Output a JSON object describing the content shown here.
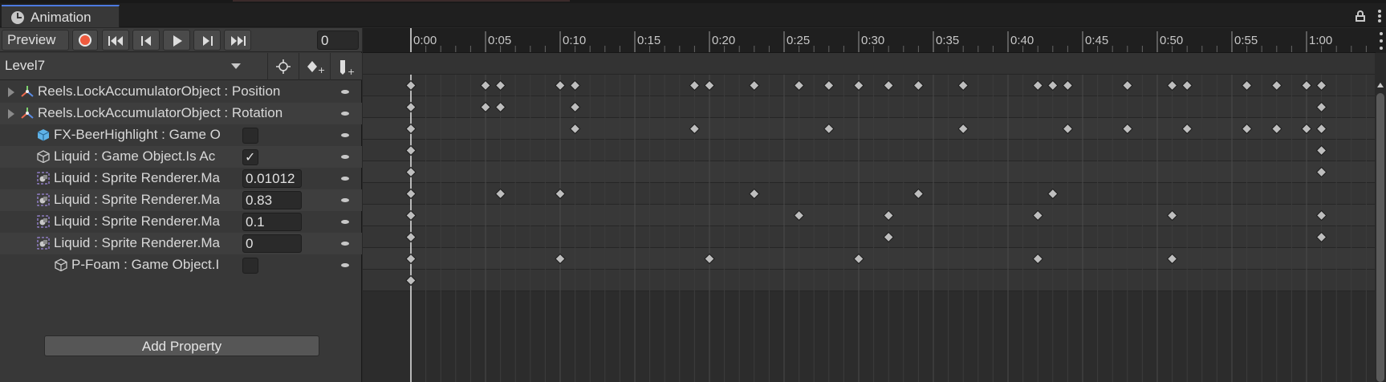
{
  "tab": {
    "title": "Animation",
    "icon": "clock-icon"
  },
  "toolbar": {
    "preview_label": "Preview",
    "current_frame": "0",
    "clip_name": "Level7"
  },
  "properties": [
    {
      "name": "Reels.LockAccumulatorObject : Position",
      "icon": "transform-icon",
      "foldout": true,
      "value_type": "none",
      "value": ""
    },
    {
      "name": "Reels.LockAccumulatorObject : Rotation",
      "icon": "transform-icon",
      "foldout": true,
      "value_type": "none",
      "value": ""
    },
    {
      "name": "FX-BeerHighlight : Game O",
      "icon": "gameobject-blue-icon",
      "foldout": false,
      "value_type": "checkbox",
      "value": ""
    },
    {
      "name": "Liquid : Game Object.Is Ac",
      "icon": "gameobject-icon",
      "foldout": false,
      "value_type": "checkbox",
      "value": "✓"
    },
    {
      "name": "Liquid : Sprite Renderer.Ma",
      "icon": "sprite-renderer-icon",
      "foldout": false,
      "value_type": "number",
      "value": "0.01012"
    },
    {
      "name": "Liquid : Sprite Renderer.Ma",
      "icon": "sprite-renderer-icon",
      "foldout": false,
      "value_type": "number",
      "value": "0.83"
    },
    {
      "name": "Liquid : Sprite Renderer.Ma",
      "icon": "sprite-renderer-icon",
      "foldout": false,
      "value_type": "number",
      "value": "0.1"
    },
    {
      "name": "Liquid : Sprite Renderer.Ma",
      "icon": "sprite-renderer-icon",
      "foldout": false,
      "value_type": "number",
      "value": "0"
    },
    {
      "name": "P-Foam : Game Object.I",
      "icon": "gameobject-icon",
      "foldout": false,
      "value_type": "checkbox",
      "value": ""
    }
  ],
  "add_property_label": "Add Property",
  "timeline": {
    "tick_labels": [
      "0:00",
      "0:05",
      "0:10",
      "0:15",
      "0:20",
      "0:25",
      "0:30",
      "0:35",
      "0:40",
      "0:45",
      "0:50",
      "0:55",
      "1:00"
    ],
    "summary_keys": [
      0,
      5,
      6,
      10,
      11,
      19,
      20,
      23,
      26,
      28,
      30,
      32,
      34,
      37,
      42,
      43,
      44,
      48,
      51,
      52,
      56,
      58,
      60,
      61
    ],
    "row_keys": [
      [
        0,
        5,
        6,
        11,
        61
      ],
      [
        0,
        11,
        19,
        28,
        37,
        44,
        48,
        52,
        56,
        58,
        60,
        61
      ],
      [
        0,
        61
      ],
      [
        0,
        61
      ],
      [
        0,
        6,
        10,
        23,
        34,
        43
      ],
      [
        0,
        26,
        32,
        42,
        51,
        61
      ],
      [
        0,
        32,
        61
      ],
      [
        0,
        10,
        20,
        30,
        42,
        51
      ],
      [
        0
      ]
    ]
  },
  "colors": {
    "record": "#ef5a3e",
    "keyframe": "#bebebe",
    "playhead": "#e6e6e6",
    "accent": "#4c7ae0"
  }
}
